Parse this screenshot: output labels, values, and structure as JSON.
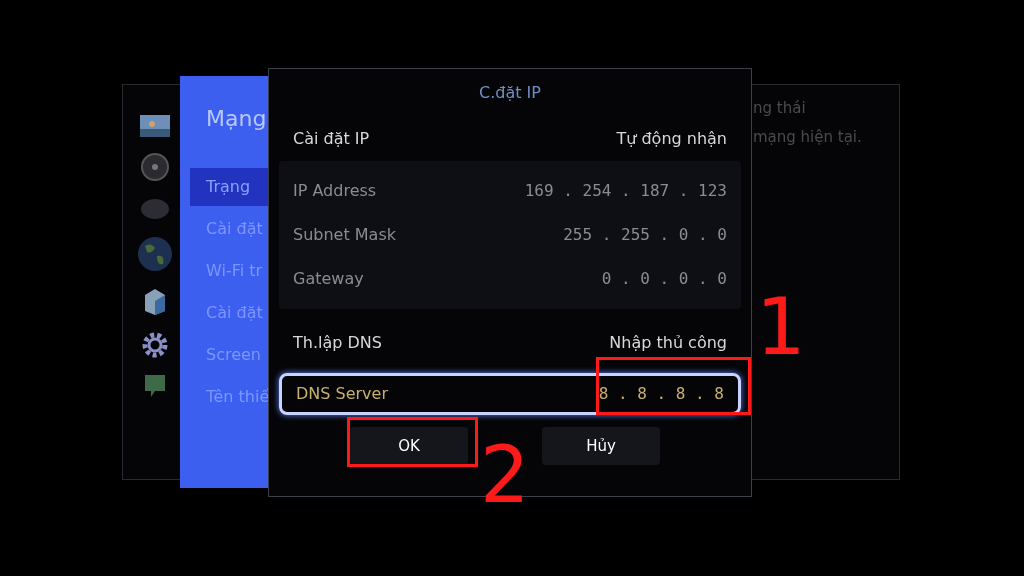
{
  "side_menu": {
    "title": "Mạng",
    "items": [
      {
        "label": "Trạng",
        "selected": true
      },
      {
        "label": "Cài đặt",
        "selected": false
      },
      {
        "label": "Wi-Fi tr",
        "selected": false
      },
      {
        "label": "Cài đặt",
        "selected": false
      },
      {
        "label": "Screen",
        "selected": false
      },
      {
        "label": "Tên thiế",
        "selected": false
      }
    ]
  },
  "background_panel": {
    "lines": [
      "ng thái",
      "mạng hiện tại."
    ]
  },
  "dialog": {
    "title": "C.đặt IP",
    "ip_setting": {
      "label": "Cài đặt IP",
      "value": "Tự động nhận"
    },
    "ip_fields": [
      {
        "label": "IP Address",
        "value": "169 . 254 . 187 . 123"
      },
      {
        "label": "Subnet Mask",
        "value": "255 . 255 . 0 . 0"
      },
      {
        "label": "Gateway",
        "value": "0 . 0 . 0 . 0"
      }
    ],
    "dns_setting": {
      "label": "Th.lập DNS",
      "value": "Nhập thủ công"
    },
    "dns_server": {
      "label": "DNS Server",
      "value": "8 . 8 . 8 . 8",
      "focused": true
    },
    "buttons": [
      "OK",
      "Hủy"
    ]
  },
  "annotations": [
    "1",
    "2"
  ]
}
